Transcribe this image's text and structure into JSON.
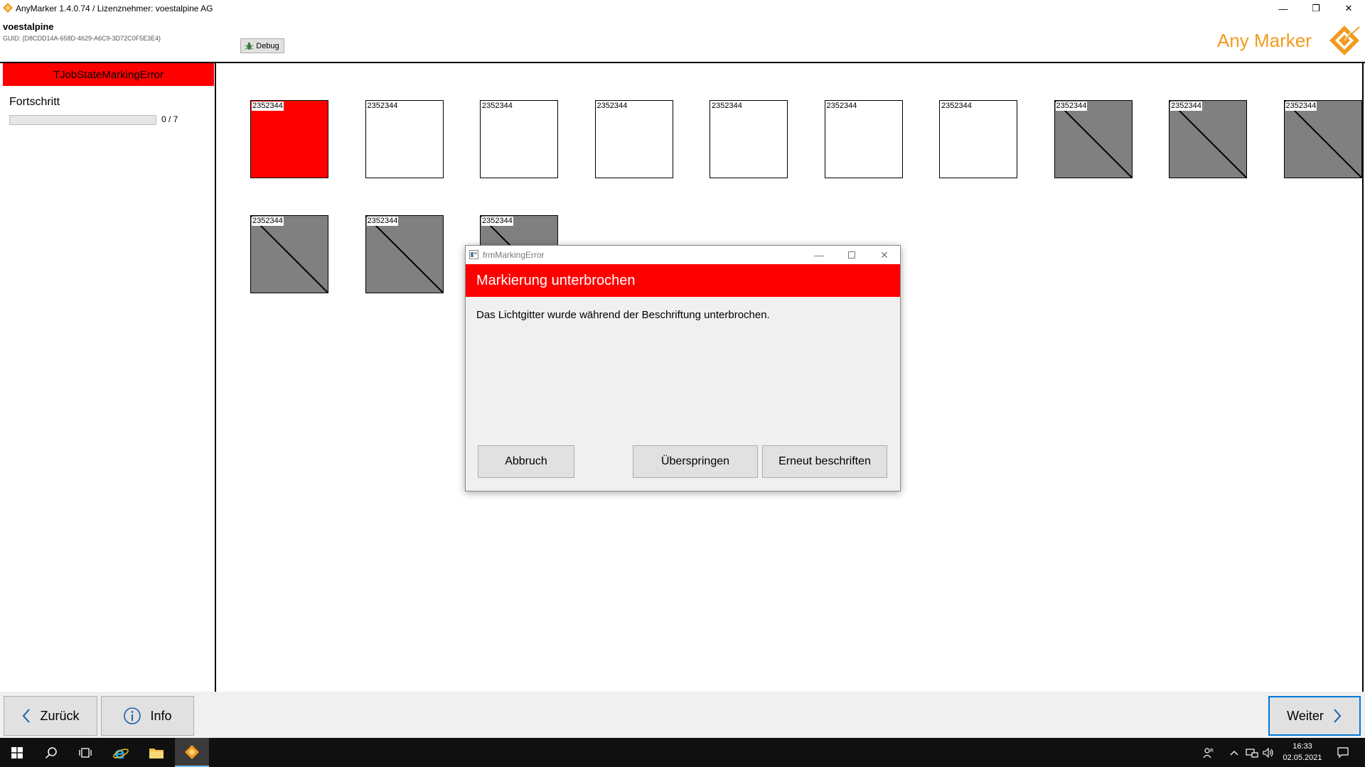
{
  "window": {
    "title": "AnyMarker 1.4.0.74 / Lizenznehmer: voestalpine AG",
    "company": "voestalpine",
    "guid": "GUID: {D8CDD14A-658D-4629-A6C9-3D72C0F5E3E4}",
    "debug_label": "Debug",
    "logo_text_any": "Any",
    "logo_text_marker": "Marker",
    "minimize_glyph": "—",
    "restore_glyph": "❐",
    "close_glyph": "✕"
  },
  "left_panel": {
    "state": "TJobStateMarkingError",
    "progress_label": "Fortschritt",
    "progress_text": "0 / 7",
    "progress_fraction": 0
  },
  "tiles": [
    {
      "label": "2352344",
      "state": "error"
    },
    {
      "label": "2352344",
      "state": "open"
    },
    {
      "label": "2352344",
      "state": "open"
    },
    {
      "label": "2352344",
      "state": "open"
    },
    {
      "label": "2352344",
      "state": "open"
    },
    {
      "label": "2352344",
      "state": "open"
    },
    {
      "label": "2352344",
      "state": "open"
    },
    {
      "label": "2352344",
      "state": "done"
    },
    {
      "label": "2352344",
      "state": "done"
    },
    {
      "label": "2352344",
      "state": "done"
    },
    {
      "label": "2352344",
      "state": "done"
    },
    {
      "label": "2352344",
      "state": "done"
    },
    {
      "label": "2352344",
      "state": "done"
    }
  ],
  "dialog": {
    "window_title": "frmMarkingError",
    "header": "Markierung unterbrochen",
    "message": "Das Lichtgitter wurde während der Beschriftung unterbrochen.",
    "cancel_label": "Abbruch",
    "skip_label": "Überspringen",
    "retry_label": "Erneut beschriften"
  },
  "bottom": {
    "back_label": "Zurück",
    "info_label": "Info",
    "next_label": "Weiter"
  },
  "taskbar": {
    "time": "16:33",
    "date": "02.05.2021"
  },
  "colors": {
    "error": "#ff0000",
    "done": "#808080",
    "accent": "#0078d7",
    "logo_orange": "#f39a1e"
  }
}
